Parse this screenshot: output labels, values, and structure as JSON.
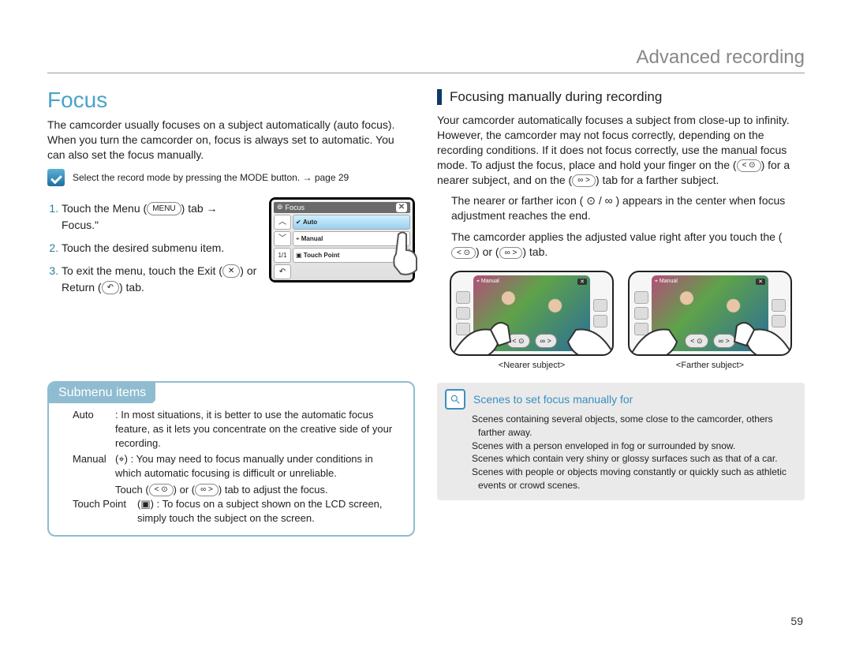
{
  "header": {
    "section": "Advanced recording"
  },
  "left": {
    "heading": "Focus",
    "intro": "The camcorder usually focuses on a subject automatically (auto focus). When you turn the camcorder on, focus is always set to automatic. You can also set the focus manually.",
    "mode_note": "Select the record mode by pressing the MODE button. → page 29",
    "steps": {
      "s1a": "Touch the Menu",
      "s1_menu": "MENU",
      "s1b": "tab →",
      "s1c": "Focus.\"",
      "s2": "Touch the desired submenu item.",
      "s3a": "To exit the menu, touch the Exit",
      "s3_exit": "✕",
      "s3b": "or Return",
      "s3_return": "↶",
      "s3c": "tab."
    },
    "lcd": {
      "title": "Focus",
      "items": {
        "auto": "Auto",
        "manual": "Manual",
        "touchpoint": "Touch Point"
      },
      "side": {
        "up": "︿",
        "down": "﹀",
        "page": "1/1",
        "back": "↶"
      },
      "close": "✕"
    },
    "submenu": {
      "title": "Submenu items",
      "auto_k": "Auto",
      "auto_v": ": In most situations, it is better to use the automatic focus feature, as it lets you concentrate on the creative side of your recording.",
      "manual_k": "Manual",
      "manual_icon": "⌖",
      "manual_v": ": You may need to focus manually under conditions in which automatic focusing is difficult or unreliable.",
      "manual_l2a": "Touch",
      "manual_near": "< ⊙",
      "manual_l2b": "or",
      "manual_far": "∞ >",
      "manual_l2c": "tab to adjust the focus.",
      "tp_k": "Touch Point",
      "tp_icon": "▣",
      "tp_v": ": To focus on a subject shown on the LCD screen, simply touch the subject on the screen."
    }
  },
  "right": {
    "heading": "Focusing manually during recording",
    "p1a": "Your camcorder automatically focuses a subject from close-up to infinity. However, the camcorder may not focus correctly, depending on the recording conditions. If it does not focus correctly, use the manual focus mode. To adjust the focus, place and hold your finger on the",
    "near_pill": "< ⊙",
    "p1b": "for a nearer subject, and on the",
    "far_pill": "∞ >",
    "p1c": "tab for a farther subject.",
    "p2a": "The nearer or farther icon (",
    "near_sym": "⊙",
    "p2b": "/",
    "far_sym": "∞",
    "p2c": ") appears in the center when focus adjustment reaches the end.",
    "p3a": "The camcorder applies the adjusted value right after you touch the",
    "p3b": "or",
    "p3c": "tab.",
    "device_manual_label": "Manual",
    "captions": {
      "nearer": "<Nearer subject>",
      "farther": "<Farther subject>"
    },
    "info": {
      "title": "Scenes to set focus manually for",
      "l1": "Scenes containing several objects, some close to the camcorder, others farther away.",
      "l2": "Scenes with a person enveloped in fog or surrounded by snow.",
      "l3": "Scenes which contain very shiny or glossy surfaces such as that of a car.",
      "l4": "Scenes with people or objects moving constantly or quickly such as athletic events or crowd scenes."
    }
  },
  "page_number": "59"
}
